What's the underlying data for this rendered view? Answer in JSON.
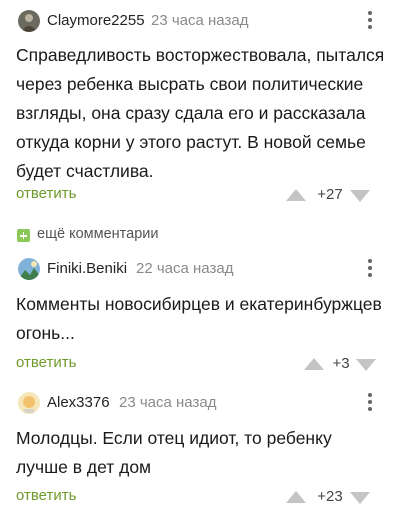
{
  "comments": [
    {
      "author": "Claymore2255",
      "time": "23 часа назад",
      "text": "Справедливость восторжествовала, пытался через ребенка высрать свои политические взгляды, она сразу сдала его и рассказала откуда корни у этого растут. В новой семье будет счастлива.",
      "reply_label": "ответить",
      "score": "+27"
    },
    {
      "author": "Finiki.Beniki",
      "time": "22 часа назад",
      "text": "Комменты новосибирцев и екатеринбуржцев огонь...",
      "reply_label": "ответить",
      "score": "+3"
    },
    {
      "author": "Alex3376",
      "time": "23 часа назад",
      "text": "Молодцы. Если отец идиот, то ребенку лучше в дет дом",
      "reply_label": "ответить",
      "score": "+23"
    }
  ],
  "more_comments_label": "ещё комментарии",
  "colors": {
    "reply": "#6f9a2b",
    "more_icon": "#8ac858",
    "vote_arrow": "#c4c4c4",
    "time": "#8a8a8a"
  }
}
